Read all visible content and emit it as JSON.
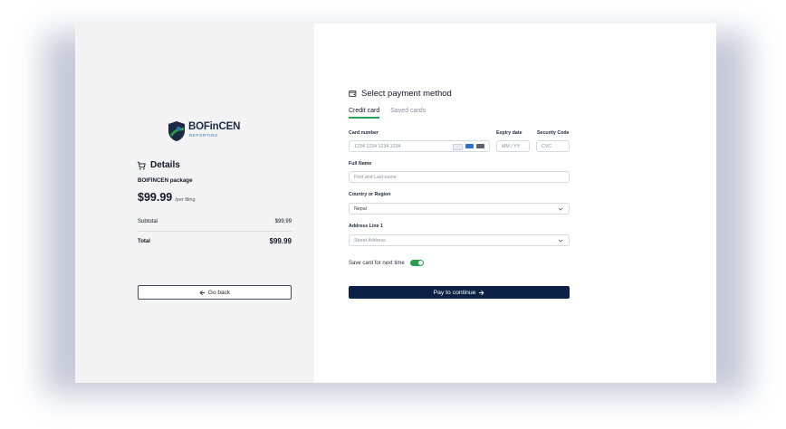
{
  "brand": {
    "name": "BOFinCEN",
    "tagline": "REPORTING"
  },
  "details": {
    "title": "Details",
    "package_name": "BOIFINCEN package",
    "price": "$99.99",
    "price_suffix": "/per filing",
    "subtotal_label": "Subtotal",
    "subtotal_value": "$99.99",
    "total_label": "Total",
    "total_value": "$99.99",
    "go_back_label": "Go back"
  },
  "payment": {
    "title": "Select payment method",
    "tabs": [
      {
        "label": "Credit card",
        "active": true
      },
      {
        "label": "Saved cards",
        "active": false
      }
    ],
    "card_number": {
      "label": "Card number",
      "placeholder": "1234 1234 1234 1234"
    },
    "expiry": {
      "label": "Expiry date",
      "placeholder": "MM / YY"
    },
    "security": {
      "label": "Security Code",
      "placeholder": "CVC"
    },
    "full_name": {
      "label": "Full Name",
      "placeholder": "First and Last name"
    },
    "country": {
      "label": "Country or Region",
      "value": "Nepal"
    },
    "address": {
      "label": "Address Line 1",
      "placeholder": "Street Address"
    },
    "save_card": {
      "label": "Save card for next time",
      "enabled": true
    },
    "pay_label": "Pay to continue"
  },
  "colors": {
    "accent_green": "#23a35a",
    "primary_navy": "#0d2147"
  },
  "icons": [
    "cart-icon",
    "wallet-icon",
    "arrow-left-icon",
    "arrow-right-icon",
    "chevron-down-icon",
    "visa-icon",
    "amex-icon",
    "mastercard-icon"
  ]
}
